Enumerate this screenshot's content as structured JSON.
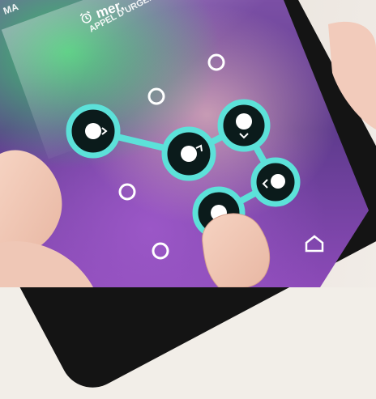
{
  "status": {
    "carrier": "MA",
    "time": "mer."
  },
  "emergency_call": "APPEL D'URGENCE",
  "icons": {
    "alarm": "alarm-clock-icon",
    "home": "home-icon"
  },
  "colors": {
    "pattern": "#5ce1d9",
    "dot": "#ffffff",
    "node_fill": "#0b1b1b"
  }
}
